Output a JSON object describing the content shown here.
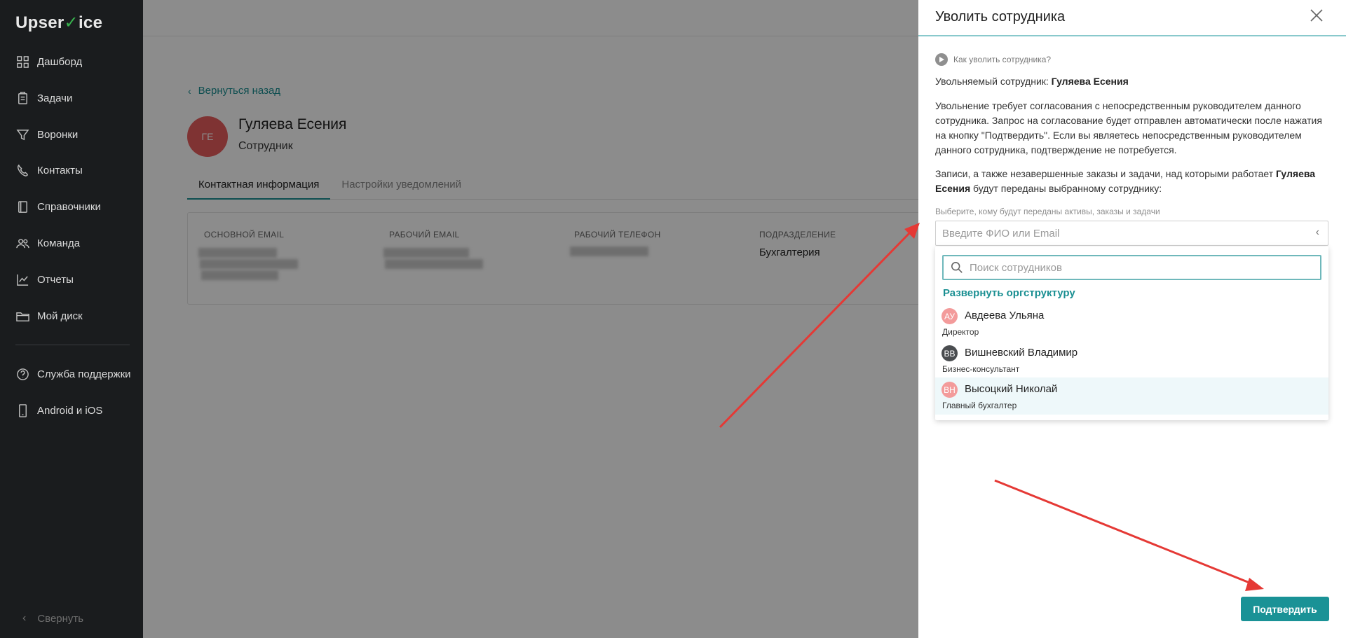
{
  "app": {
    "logo": {
      "part1": "Upser",
      "mark": "✓",
      "part2": "ice"
    }
  },
  "sidebar": {
    "items": [
      {
        "label": "Дашборд",
        "icon": "dashboard-icon"
      },
      {
        "label": "Задачи",
        "icon": "tasks-icon"
      },
      {
        "label": "Воронки",
        "icon": "funnel-icon"
      },
      {
        "label": "Контакты",
        "icon": "contacts-icon"
      },
      {
        "label": "Справочники",
        "icon": "book-icon"
      },
      {
        "label": "Команда",
        "icon": "team-icon"
      },
      {
        "label": "Отчеты",
        "icon": "chart-icon"
      },
      {
        "label": "Мой диск",
        "icon": "folder-icon"
      }
    ],
    "secondary": [
      {
        "label": "Служба поддержки",
        "icon": "help-icon"
      },
      {
        "label": "Android и iOS",
        "icon": "phone-icon"
      }
    ],
    "collapse_label": "Свернуть"
  },
  "main": {
    "back_label": "Вернуться назад",
    "employee": {
      "initials": "ГЕ",
      "name": "Гуляева Есения",
      "role": "Сотрудник"
    },
    "tabs": [
      {
        "label": "Контактная информация",
        "active": true
      },
      {
        "label": "Настройки уведомлений",
        "active": false
      }
    ],
    "fields": [
      {
        "label": "Основной email",
        "value": ""
      },
      {
        "label": "Рабочий email",
        "value": ""
      },
      {
        "label": "Рабочий телефон",
        "value": ""
      },
      {
        "label": "Подразделение",
        "value": "Бухгалтерия"
      }
    ]
  },
  "drawer": {
    "title": "Уволить сотрудника",
    "help_link": "Как уволить сотрудника?",
    "dismissed_prefix": "Увольняемый сотрудник: ",
    "dismissed_name": "Гуляева Есения",
    "paragraph1": "Увольнение требует согласования с непосредственным руководителем данного сотрудника. Запрос на согласование будет отправлен автоматически после нажатия на кнопку \"Подтвердить\". Если вы являетесь непосредственным руководителем данного сотрудника, подтверждение не потребуется.",
    "paragraph2_prefix": "Записи, а также незавершенные заказы и задачи, над которыми работает ",
    "paragraph2_name": "Гуляева Есения",
    "paragraph2_suffix": " будут переданы выбранному сотруднику:",
    "select_label": "Выберите, кому будут переданы активы, заказы и задачи",
    "select_placeholder": "Введите ФИО или Email",
    "search_placeholder": "Поиск сотрудников",
    "expand_label": "Развернуть оргструктуру",
    "employees": [
      {
        "initials": "АУ",
        "name": "Авдеева Ульяна",
        "role": "Директор",
        "color": "#f39b9b"
      },
      {
        "initials": "ВВ",
        "name": "Вишневский Владимир",
        "role": "Бизнес-консультант",
        "color": "#4a4d50"
      },
      {
        "initials": "ВН",
        "name": "Высоцкий Николай",
        "role": "Главный бухгалтер",
        "color": "#f39b9b"
      }
    ],
    "confirm_label": "Подтвердить"
  },
  "colors": {
    "accent": "#1a9296",
    "sidebar_bg": "#1a1c1e",
    "arrow": "#e53935"
  }
}
